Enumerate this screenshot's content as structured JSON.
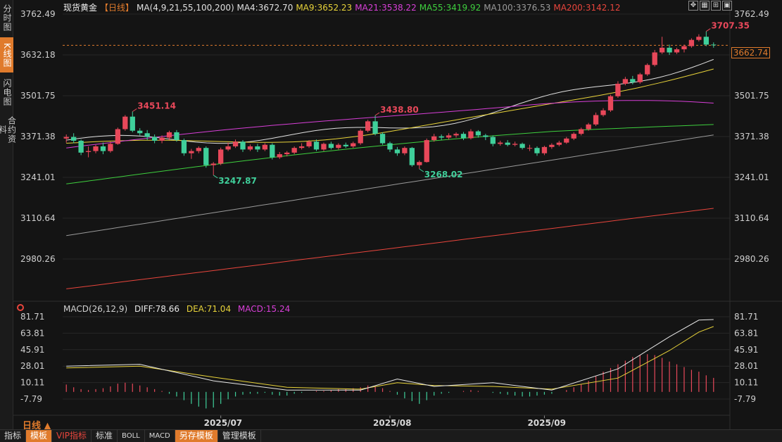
{
  "side_tabs": [
    "分时图",
    "K线图",
    "闪电图",
    "合约资料"
  ],
  "header": {
    "name": "现货黄金",
    "period": "【日线】",
    "ma4": "MA(4,9,21,55,100,200)  MA4:3672.70",
    "ma9": "MA9:3652.23",
    "ma21": "MA21:3538.22",
    "ma55": "MA55:3419.92",
    "ma100": "MA100:3376.53",
    "ma200": "MA200:3142.12"
  },
  "tool_icons": [
    "expand-icon",
    "crosshair-icon",
    "chart-icon",
    "window-icon"
  ],
  "macd_header": {
    "name": "MACD(26,12,9)",
    "diff": "DIFF:78.66",
    "dea": "DEA:71.04",
    "macd": "MACD:15.24"
  },
  "period_label": "日线 ▲",
  "last_price": "3662.74",
  "bottom_tabs": [
    "指标",
    "模板",
    "VIP指标",
    "标准",
    "BOLL",
    "MACD",
    "另存模板",
    "管理模板"
  ],
  "colors": {
    "up": "#e8485a",
    "down": "#3fcf9a",
    "ma4": "#e0e0e0",
    "ma9": "#e8d33a",
    "ma21": "#d83fd8",
    "ma55": "#3ecf3e",
    "ma100": "#9a9a9a",
    "ma200": "#e8453c",
    "accent": "#e07b2c"
  },
  "chart_data": [
    {
      "type": "candlestick",
      "title": "现货黄金 日线",
      "y_ticks": [
        "3762.49",
        "3632.18",
        "3501.75",
        "3371.38",
        "3241.01",
        "3110.64",
        "2980.26"
      ],
      "ylim": [
        2890,
        3762.49
      ],
      "x_ticks": [
        {
          "label": "2025/07",
          "index": 21
        },
        {
          "label": "2025/08",
          "index": 44
        },
        {
          "label": "2025/09",
          "index": 65
        }
      ],
      "candles": [
        [
          3365,
          3370,
          3378,
          3352
        ],
        [
          3370,
          3358,
          3382,
          3350
        ],
        [
          3358,
          3320,
          3362,
          3312
        ],
        [
          3322,
          3325,
          3340,
          3305
        ],
        [
          3325,
          3340,
          3345,
          3318
        ],
        [
          3340,
          3325,
          3352,
          3315
        ],
        [
          3325,
          3348,
          3355,
          3320
        ],
        [
          3348,
          3395,
          3400,
          3345
        ],
        [
          3395,
          3435,
          3440,
          3390
        ],
        [
          3435,
          3390,
          3451.14,
          3385
        ],
        [
          3390,
          3382,
          3398,
          3375
        ],
        [
          3382,
          3370,
          3392,
          3360
        ],
        [
          3370,
          3358,
          3378,
          3350
        ],
        [
          3358,
          3368,
          3375,
          3350
        ],
        [
          3368,
          3385,
          3390,
          3360
        ],
        [
          3385,
          3360,
          3392,
          3355
        ],
        [
          3360,
          3318,
          3365,
          3310
        ],
        [
          3318,
          3325,
          3332,
          3300
        ],
        [
          3325,
          3335,
          3340,
          3318
        ],
        [
          3335,
          3280,
          3340,
          3272
        ],
        [
          3280,
          3285,
          3290,
          3247.87
        ],
        [
          3285,
          3330,
          3336,
          3280
        ],
        [
          3330,
          3340,
          3352,
          3325
        ],
        [
          3340,
          3355,
          3362,
          3335
        ],
        [
          3355,
          3330,
          3360,
          3322
        ],
        [
          3330,
          3340,
          3346,
          3325
        ],
        [
          3340,
          3330,
          3348,
          3322
        ],
        [
          3330,
          3345,
          3350,
          3325
        ],
        [
          3345,
          3305,
          3350,
          3298
        ],
        [
          3305,
          3315,
          3322,
          3300
        ],
        [
          3315,
          3320,
          3325,
          3308
        ],
        [
          3320,
          3335,
          3340,
          3315
        ],
        [
          3335,
          3340,
          3350,
          3330
        ],
        [
          3340,
          3355,
          3360,
          3335
        ],
        [
          3355,
          3330,
          3362,
          3325
        ],
        [
          3330,
          3348,
          3352,
          3325
        ],
        [
          3348,
          3335,
          3355,
          3330
        ],
        [
          3335,
          3345,
          3350,
          3330
        ],
        [
          3345,
          3340,
          3352,
          3335
        ],
        [
          3340,
          3350,
          3355,
          3335
        ],
        [
          3350,
          3390,
          3395,
          3345
        ],
        [
          3390,
          3420,
          3425,
          3385
        ],
        [
          3420,
          3380,
          3438.8,
          3375
        ],
        [
          3380,
          3350,
          3385,
          3345
        ],
        [
          3350,
          3330,
          3355,
          3322
        ],
        [
          3330,
          3318,
          3338,
          3310
        ],
        [
          3318,
          3335,
          3340,
          3312
        ],
        [
          3335,
          3280,
          3338,
          3275
        ],
        [
          3280,
          3290,
          3295,
          3268.02
        ],
        [
          3290,
          3360,
          3365,
          3288
        ],
        [
          3360,
          3372,
          3380,
          3355
        ],
        [
          3372,
          3368,
          3378,
          3360
        ],
        [
          3368,
          3375,
          3382,
          3362
        ],
        [
          3375,
          3380,
          3385,
          3368
        ],
        [
          3380,
          3366,
          3386,
          3360
        ],
        [
          3366,
          3388,
          3395,
          3362
        ],
        [
          3388,
          3375,
          3392,
          3368
        ],
        [
          3375,
          3370,
          3380,
          3360
        ],
        [
          3370,
          3348,
          3375,
          3340
        ],
        [
          3348,
          3352,
          3358,
          3342
        ],
        [
          3352,
          3345,
          3360,
          3340
        ],
        [
          3345,
          3348,
          3355,
          3340
        ],
        [
          3348,
          3335,
          3352,
          3330
        ],
        [
          3335,
          3335,
          3345,
          3325
        ],
        [
          3335,
          3318,
          3340,
          3310
        ],
        [
          3318,
          3338,
          3342,
          3312
        ],
        [
          3338,
          3345,
          3350,
          3332
        ],
        [
          3345,
          3352,
          3358,
          3340
        ],
        [
          3352,
          3365,
          3370,
          3348
        ],
        [
          3365,
          3380,
          3385,
          3360
        ],
        [
          3380,
          3395,
          3400,
          3375
        ],
        [
          3395,
          3410,
          3415,
          3390
        ],
        [
          3410,
          3440,
          3448,
          3405
        ],
        [
          3440,
          3455,
          3462,
          3435
        ],
        [
          3455,
          3500,
          3505,
          3450
        ],
        [
          3500,
          3540,
          3548,
          3495
        ],
        [
          3540,
          3555,
          3562,
          3535
        ],
        [
          3555,
          3545,
          3565,
          3538
        ],
        [
          3545,
          3570,
          3575,
          3540
        ],
        [
          3570,
          3600,
          3605,
          3565
        ],
        [
          3600,
          3640,
          3648,
          3595
        ],
        [
          3640,
          3655,
          3690,
          3635
        ],
        [
          3655,
          3640,
          3665,
          3632
        ],
        [
          3640,
          3650,
          3655,
          3635
        ],
        [
          3650,
          3660,
          3665,
          3640
        ],
        [
          3660,
          3680,
          3685,
          3655
        ],
        [
          3680,
          3690,
          3698,
          3675
        ],
        [
          3690,
          3665,
          3707.35,
          3660
        ],
        [
          3665,
          3663,
          3672,
          3655
        ]
      ],
      "annotations": [
        {
          "label": "3451.14",
          "index": 9,
          "value": 3451.14
        },
        {
          "label": "3438.80",
          "index": 42,
          "value": 3438.8
        },
        {
          "label": "3707.35",
          "index": 87,
          "value": 3707.35
        },
        {
          "label": "3247.87",
          "index": 20,
          "value": 3247.87
        },
        {
          "label": "3268.02",
          "index": 48,
          "value": 3268.02
        }
      ],
      "moving_averages": [
        {
          "name": "MA4",
          "start": [
            0,
            3360
          ],
          "end": [
            88,
            3672.7
          ]
        },
        {
          "name": "MA9",
          "start": [
            0,
            3350
          ],
          "end": [
            88,
            3652.23
          ]
        },
        {
          "name": "MA21",
          "start": [
            0,
            3335
          ],
          "end": [
            88,
            3538.22
          ]
        },
        {
          "name": "MA55",
          "start": [
            0,
            3220
          ],
          "end": [
            88,
            3419.92
          ]
        },
        {
          "name": "MA100",
          "start": [
            0,
            3055
          ],
          "end": [
            88,
            3376.53
          ]
        },
        {
          "name": "MA200",
          "start": [
            0,
            2885
          ],
          "end": [
            88,
            3142.12
          ]
        }
      ]
    },
    {
      "type": "bar",
      "title": "MACD(26,12,9)",
      "y_ticks": [
        "81.71",
        "63.81",
        "45.91",
        "28.01",
        "10.11",
        "-7.79"
      ],
      "ylim": [
        -15,
        81.71
      ],
      "diff_points": [
        [
          0,
          28
        ],
        [
          10,
          30
        ],
        [
          20,
          12
        ],
        [
          30,
          2
        ],
        [
          40,
          2
        ],
        [
          45,
          14
        ],
        [
          50,
          6
        ],
        [
          58,
          10
        ],
        [
          66,
          2
        ],
        [
          75,
          25
        ],
        [
          82,
          60
        ],
        [
          86,
          78
        ],
        [
          88,
          78.66
        ]
      ],
      "dea_points": [
        [
          0,
          26
        ],
        [
          10,
          28
        ],
        [
          20,
          16
        ],
        [
          30,
          5
        ],
        [
          40,
          3
        ],
        [
          45,
          10
        ],
        [
          50,
          7
        ],
        [
          58,
          6
        ],
        [
          66,
          3
        ],
        [
          75,
          15
        ],
        [
          82,
          45
        ],
        [
          86,
          65
        ],
        [
          88,
          71.04
        ]
      ],
      "histogram": [
        8,
        5,
        3,
        2,
        3,
        4,
        6,
        9,
        10,
        9,
        7,
        5,
        3,
        1,
        -2,
        -5,
        -9,
        -13,
        -16,
        -18,
        -17,
        -13,
        -8,
        -5,
        -3,
        -2,
        -2,
        -1,
        -3,
        -4,
        -4,
        -2,
        -1,
        0,
        1,
        1,
        2,
        3,
        3,
        4,
        5,
        7,
        6,
        4,
        1,
        -3,
        -7,
        -10,
        -13,
        -9,
        -4,
        -2,
        -1,
        0,
        1,
        2,
        1,
        0,
        -1,
        -2,
        -3,
        -4,
        -5,
        -5,
        -4,
        -3,
        -2,
        0,
        2,
        5,
        8,
        12,
        17,
        22,
        26,
        30,
        34,
        38,
        40,
        41,
        40,
        37,
        33,
        30,
        27,
        24,
        22,
        18,
        15.24
      ]
    }
  ]
}
